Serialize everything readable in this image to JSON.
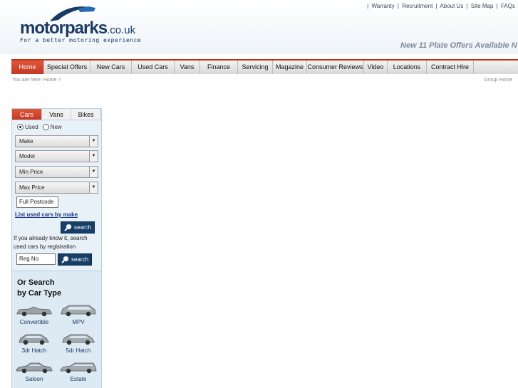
{
  "header": {
    "logo_main": "motorparks",
    "logo_tld": ".co.uk",
    "tagline": "For a better motoring experience",
    "toplinks": [
      "Warranty",
      "Recruitment",
      "About Us",
      "Site Map",
      "FAQs"
    ],
    "promo": "New 11 Plate Offers Available N"
  },
  "nav": {
    "items": [
      "Home",
      "Special Offers",
      "New Cars",
      "Used Cars",
      "Vans",
      "Finance",
      "Servicing",
      "Magazine",
      "Consumer Reviews",
      "Video",
      "Locations",
      "Contract Hire"
    ]
  },
  "breadcrumb": "You are here: Home >",
  "grouphome": "Group Home",
  "search": {
    "tabs": [
      "Cars",
      "Vans",
      "Bikes"
    ],
    "radio_used": "Used",
    "radio_new": "New",
    "make": "Make",
    "model": "Model",
    "min_price": "Min Price",
    "max_price": "Max Price",
    "postcode_placeholder": "Full Postcode",
    "list_link": "List used cars by make",
    "search_label": "search",
    "know_text": "If you already know it, search used cars by registration",
    "reg_placeholder": "Reg No"
  },
  "cartype": {
    "title_line1": "Or Search",
    "title_line2": "by Car Type",
    "items": [
      "Convertible",
      "MPV",
      "3dr Hatch",
      "5dr Hatch",
      "Saloon",
      "Estate"
    ]
  },
  "colors": {
    "accent": "#c23a22",
    "brand": "#1a3a66",
    "panel": "#e8f1f8"
  }
}
